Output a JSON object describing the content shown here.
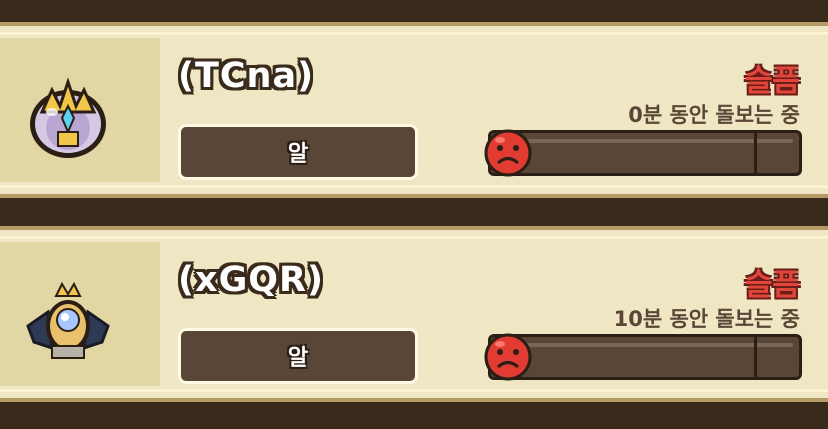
{
  "pets": [
    {
      "name": "(TCna)",
      "stage_label": "알",
      "mood": "슬픔",
      "care_time": "0분 동안 돌보는 중",
      "icon": "winged-egg-icon",
      "mood_icon": "sad-face-icon",
      "care_progress": 0
    },
    {
      "name": "(xGQR)",
      "stage_label": "알",
      "mood": "슬픔",
      "care_time": "10분 동안 돌보는 중",
      "icon": "dark-winged-egg-icon",
      "mood_icon": "sad-face-icon",
      "care_progress": 0
    }
  ],
  "colors": {
    "card_bg": "#efe6c4",
    "mood_red": "#e0463b",
    "bar_brown": "#5a4636"
  }
}
